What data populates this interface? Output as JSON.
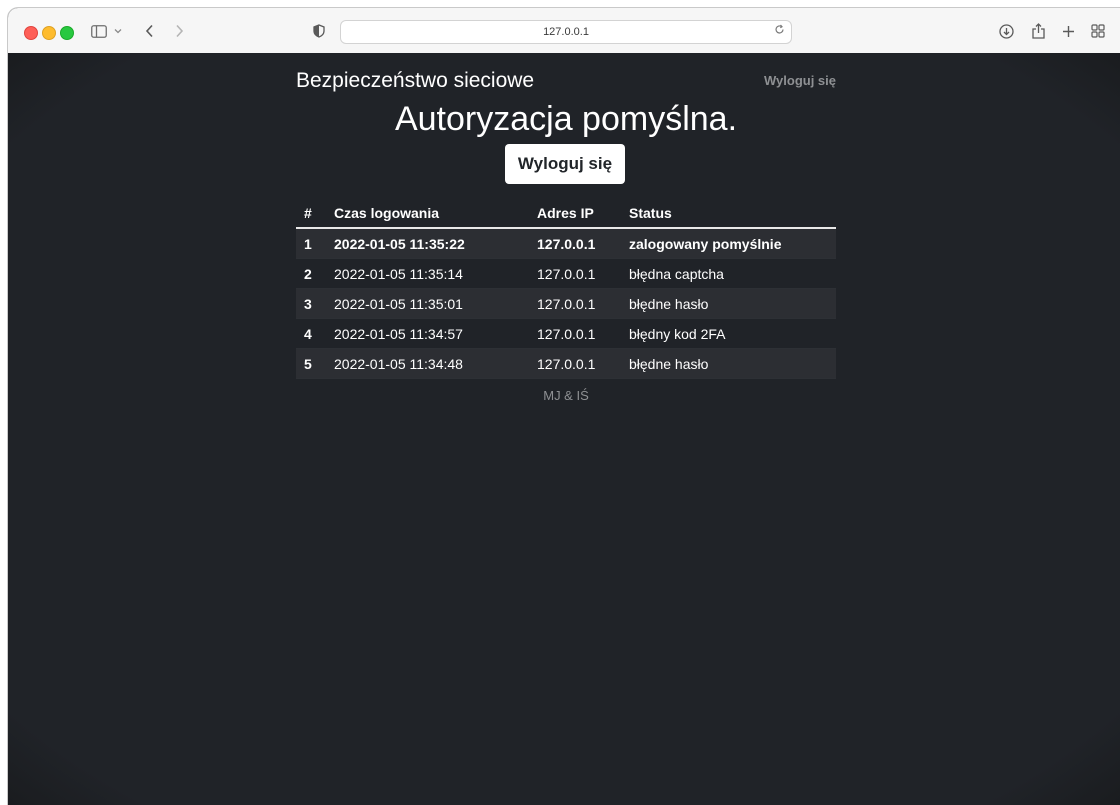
{
  "browser": {
    "url": "127.0.0.1",
    "icons": {
      "sidebar": "sidebar-icon",
      "chevron": "chevron-down-icon",
      "back": "back-icon",
      "forward": "forward-icon",
      "shield": "shield-icon",
      "reload": "reload-icon",
      "download": "download-icon",
      "share": "share-icon",
      "new_tab": "plus-icon",
      "tabs": "tab-overview-icon"
    }
  },
  "navbar": {
    "brand": "Bezpieczeństwo sieciowe",
    "logout_link": "Wyloguj się"
  },
  "main": {
    "headline": "Autoryzacja pomyślna.",
    "logout_button": "Wyloguj się"
  },
  "table": {
    "headers": [
      "#",
      "Czas logowania",
      "Adres IP",
      "Status"
    ],
    "rows": [
      {
        "num": "1",
        "time": "2022-01-05 11:35:22",
        "ip": "127.0.0.1",
        "status": "zalogowany pomyślnie"
      },
      {
        "num": "2",
        "time": "2022-01-05 11:35:14",
        "ip": "127.0.0.1",
        "status": "błędna captcha"
      },
      {
        "num": "3",
        "time": "2022-01-05 11:35:01",
        "ip": "127.0.0.1",
        "status": "błędne hasło"
      },
      {
        "num": "4",
        "time": "2022-01-05 11:34:57",
        "ip": "127.0.0.1",
        "status": "błędny kod 2FA"
      },
      {
        "num": "5",
        "time": "2022-01-05 11:34:48",
        "ip": "127.0.0.1",
        "status": "błędne hasło"
      }
    ]
  },
  "footer": {
    "text": "MJ & IŚ"
  }
}
